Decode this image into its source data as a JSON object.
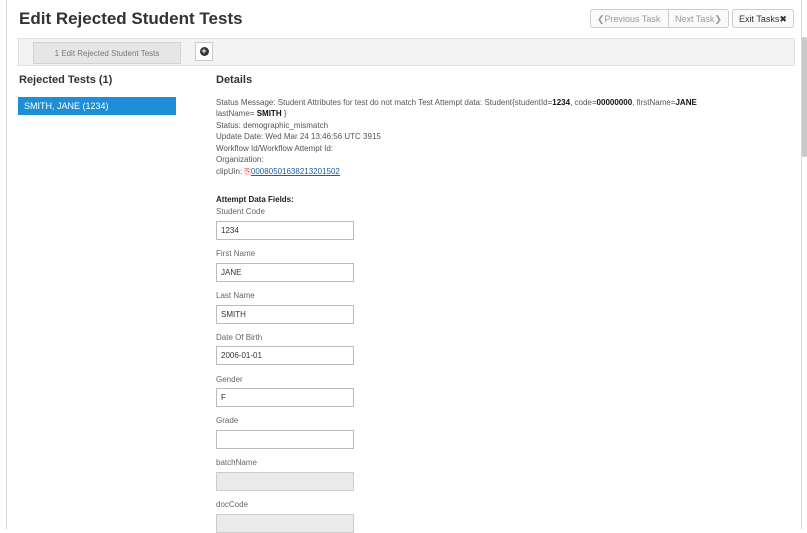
{
  "header": {
    "title": "Edit Rejected Student Tests",
    "prev_label": "❮Previous Task",
    "next_label": "Next Task❯",
    "exit_label": "Exit Tasks✖"
  },
  "tabs": {
    "active_label": "1 Edit Rejected Student Tests",
    "add_icon": "plus-circle-icon"
  },
  "sidebar": {
    "title": "Rejected Tests (1)",
    "items": [
      {
        "label": "SMITH, JANE (1234)"
      }
    ]
  },
  "details": {
    "title": "Details",
    "status_message_prefix": "Status Message: Student Attributes for test do not match Test Attempt data: Student{studentId=",
    "student_id": "1234",
    "code_prefix": ", code=",
    "code": "00000000",
    "firstname_prefix": ", firstName=",
    "first_name": "JANE",
    "lastname_prefix": "lastName=",
    "last_name": "SMITH",
    "lastname_suffix": "}",
    "status": "Status: demographic_mismatch",
    "update_date": "Update Date: Wed Mar 24 13:46:56 UTC 3915",
    "workflow": "Workflow Id/Workflow Attempt Id:",
    "organization": "Organization:",
    "clipuin_label": "clipUin:",
    "clipuin_value": "00080501638213201502"
  },
  "attempt": {
    "title": "Attempt Data Fields:",
    "fields": [
      {
        "label": "Student Code",
        "value": "1234"
      },
      {
        "label": "First Name",
        "value": "JANE"
      },
      {
        "label": "Last Name",
        "value": "SMITH"
      },
      {
        "label": "Date Of Birth",
        "value": "2006-01-01"
      },
      {
        "label": "Gender",
        "value": "F"
      },
      {
        "label": "Grade",
        "value": ""
      },
      {
        "label": "batchName",
        "value": ""
      },
      {
        "label": "docCode",
        "value": ""
      }
    ]
  }
}
